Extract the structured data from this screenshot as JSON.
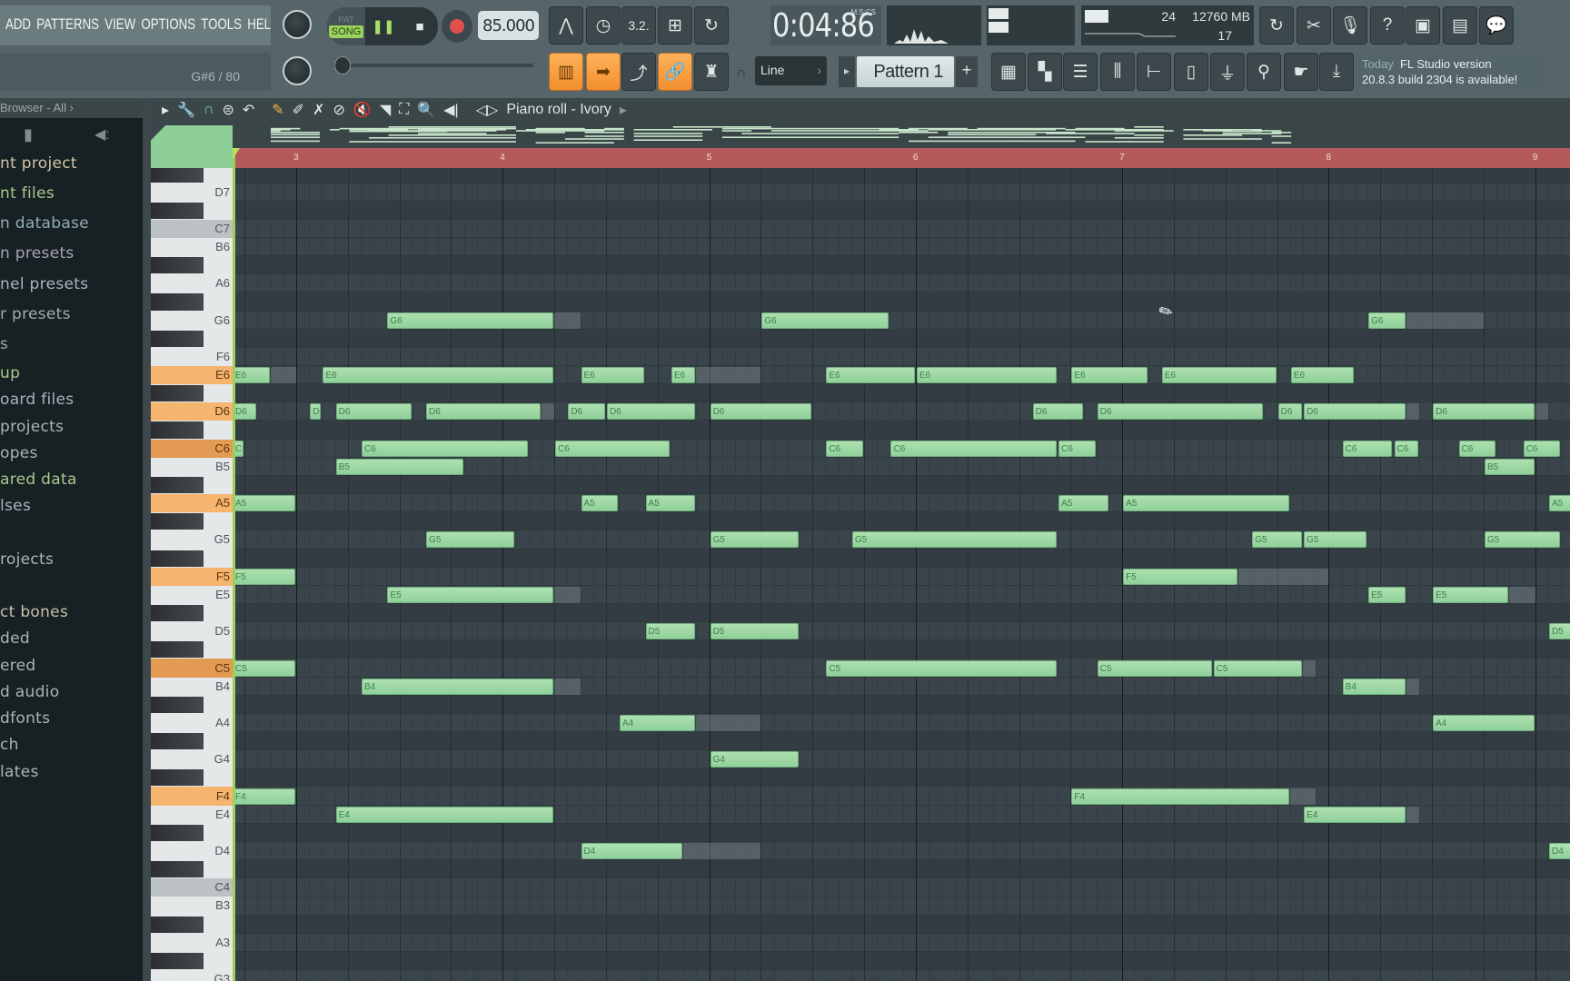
{
  "menu": {
    "items": [
      "ADD",
      "PATTERNS",
      "VIEW",
      "OPTIONS",
      "TOOLS",
      "HELP"
    ]
  },
  "hint": {
    "text": "G#6 / 80"
  },
  "transport": {
    "pat_label": "PAT",
    "song_label": "SONG",
    "mode": "SONG",
    "tempo": "85.000"
  },
  "time": {
    "value": "0:04:86",
    "format": "M:S:CS"
  },
  "cpu": {
    "cpu_value": "24",
    "memory": "12760 MB",
    "polyphony": "17"
  },
  "pattern": {
    "name": "Pattern 1",
    "add_label": "+"
  },
  "snap": {
    "value": "Line"
  },
  "news": {
    "line1_prefix": "Today",
    "line1": "FL Studio version",
    "line2": "20.8.3 build 2304 is available!"
  },
  "browser": {
    "title": "Browser - All ›",
    "items": [
      {
        "label": "nt project",
        "color": "#d2c3a8"
      },
      {
        "label": "nt files",
        "color": "#a7c98f"
      },
      {
        "label": "n database",
        "color": "#93aab6"
      },
      {
        "label": "n presets",
        "color": "#a6a3b6"
      },
      {
        "label": "nel presets",
        "color": "#a9b6c2"
      },
      {
        "label": "r presets",
        "color": "#a8a8b0"
      },
      {
        "label": "s",
        "color": "#a8a8b0"
      },
      {
        "label": "up",
        "color": "#a7c98f"
      },
      {
        "label": "oard files",
        "color": "#a3b3bf"
      },
      {
        "label": " projects",
        "color": "#a8b6b8"
      },
      {
        "label": "opes",
        "color": "#a8b6b8"
      },
      {
        "label": "ared data",
        "color": "#a7c98f"
      },
      {
        "label": "lses",
        "color": "#a3b3bf"
      },
      {
        "label": "rojects",
        "color": "#a8b6b8"
      },
      {
        "label": "ct bones",
        "color": "#c9bfae"
      },
      {
        "label": "ded",
        "color": "#a8b6b8"
      },
      {
        "label": "ered",
        "color": "#a8b6b8"
      },
      {
        "label": "d audio",
        "color": "#a8b6b8"
      },
      {
        "label": "dfonts",
        "color": "#a8b6b8"
      },
      {
        "label": "ch",
        "color": "#a8b6b8"
      },
      {
        "label": "lates",
        "color": "#a8b6b8"
      }
    ]
  },
  "piano_roll": {
    "title": "Piano roll - Ivory",
    "bar_labels": [
      "3",
      "4",
      "5",
      "6",
      "7",
      "8",
      "9"
    ],
    "key_labels": [
      "D7",
      "C7",
      "B6",
      "A6",
      "G6",
      "F6",
      "E6",
      "D6",
      "C6",
      "B5",
      "A5",
      "G5",
      "F5",
      "E5",
      "D5",
      "C5",
      "B4",
      "A4",
      "G4",
      "F4",
      "E4",
      "D4",
      "C4",
      "B3",
      "A3",
      "G3"
    ],
    "highlighted_keys": [
      "E6",
      "D6",
      "A5",
      "F5",
      "F4"
    ],
    "highlighted_root_keys": [
      "C6",
      "C5"
    ],
    "grey_keys": [
      "C7",
      "C4"
    ],
    "colors": {
      "note": "#9fd8a4",
      "key_highlight": "#f5b56f",
      "key_root": "#e39a52",
      "ruler": "#b55a5b"
    },
    "note_columns": [
      "pitch",
      "start_step",
      "length_steps",
      "ghost_tail_steps"
    ],
    "notes": [
      [
        "G6",
        39,
        13,
        2
      ],
      [
        "G6",
        68,
        10,
        0
      ],
      [
        "G6",
        115,
        3,
        6
      ],
      [
        "E6",
        27,
        3,
        2
      ],
      [
        "E6",
        34,
        18,
        0
      ],
      [
        "E6",
        54,
        5,
        0
      ],
      [
        "E6",
        61,
        2,
        5
      ],
      [
        "E6",
        73,
        7,
        0
      ],
      [
        "E6",
        80,
        11,
        0
      ],
      [
        "E6",
        92,
        6,
        0
      ],
      [
        "E6",
        99,
        9,
        0
      ],
      [
        "E6",
        109,
        5,
        0
      ],
      [
        "D6",
        27,
        2,
        0
      ],
      [
        "D6",
        33,
        1,
        0
      ],
      [
        "D6",
        35,
        6,
        0
      ],
      [
        "D6",
        42,
        9,
        1
      ],
      [
        "D6",
        53,
        3,
        0
      ],
      [
        "D6",
        56,
        7,
        0
      ],
      [
        "D6",
        64,
        8,
        0
      ],
      [
        "D6",
        89,
        4,
        0
      ],
      [
        "D6",
        94,
        13,
        0
      ],
      [
        "D6",
        108,
        2,
        0
      ],
      [
        "D6",
        110,
        8,
        1
      ],
      [
        "D6",
        120,
        8,
        1
      ],
      [
        "C6",
        27,
        1,
        0
      ],
      [
        "C6",
        37,
        13,
        0
      ],
      [
        "C6",
        52,
        9,
        0
      ],
      [
        "C6",
        73,
        3,
        0
      ],
      [
        "C6",
        78,
        13,
        0
      ],
      [
        "C6",
        91,
        3,
        0
      ],
      [
        "C6",
        113,
        4,
        0
      ],
      [
        "C6",
        117,
        2,
        0
      ],
      [
        "C6",
        122,
        3,
        0
      ],
      [
        "C6",
        127,
        3,
        0
      ],
      [
        "B5",
        35,
        10,
        0
      ],
      [
        "B5",
        124,
        4,
        0
      ],
      [
        "A5",
        27,
        5,
        0
      ],
      [
        "A5",
        54,
        3,
        0
      ],
      [
        "A5",
        59,
        4,
        0
      ],
      [
        "A5",
        91,
        4,
        0
      ],
      [
        "A5",
        96,
        13,
        0
      ],
      [
        "A5",
        129,
        2,
        0
      ],
      [
        "G5",
        42,
        7,
        0
      ],
      [
        "G5",
        64,
        7,
        0
      ],
      [
        "G5",
        75,
        16,
        0
      ],
      [
        "G5",
        106,
        4,
        0
      ],
      [
        "G5",
        110,
        5,
        0
      ],
      [
        "G5",
        124,
        6,
        0
      ],
      [
        "F5",
        27,
        5,
        0
      ],
      [
        "F5",
        96,
        9,
        7
      ],
      [
        "E5",
        39,
        13,
        2
      ],
      [
        "E5",
        115,
        3,
        0
      ],
      [
        "E5",
        120,
        6,
        2
      ],
      [
        "D5",
        59,
        4,
        0
      ],
      [
        "D5",
        64,
        7,
        0
      ],
      [
        "D5",
        129,
        2,
        0
      ],
      [
        "C5",
        27,
        5,
        0
      ],
      [
        "C5",
        73,
        18,
        0
      ],
      [
        "C5",
        94,
        9,
        0
      ],
      [
        "C5",
        103,
        7,
        1
      ],
      [
        "B4",
        37,
        15,
        2
      ],
      [
        "B4",
        113,
        5,
        1
      ],
      [
        "A4",
        57,
        6,
        5
      ],
      [
        "A4",
        120,
        8,
        0
      ],
      [
        "G4",
        64,
        7,
        0
      ],
      [
        "F4",
        27,
        5,
        0
      ],
      [
        "F4",
        92,
        17,
        2
      ],
      [
        "E4",
        35,
        17,
        0
      ],
      [
        "E4",
        110,
        8,
        1
      ],
      [
        "D4",
        54,
        8,
        6
      ],
      [
        "D4",
        129,
        2,
        0
      ]
    ]
  }
}
